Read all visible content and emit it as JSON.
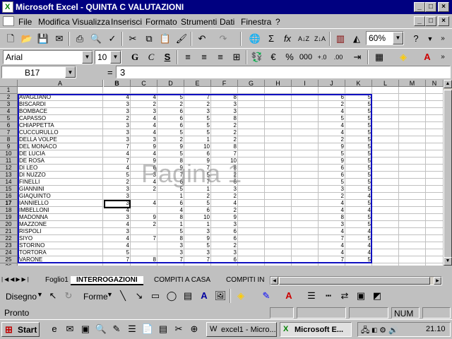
{
  "window": {
    "title": "Microsoft Excel - QUINTA C VALUTAZIONI"
  },
  "menu": [
    "File",
    "Modifica",
    "Visualizza",
    "Inserisci",
    "Formato",
    "Strumenti",
    "Dati",
    "Finestra",
    "?"
  ],
  "toolbar1": {
    "zoom": "60%"
  },
  "toolbar2": {
    "font": "Arial",
    "size": "10"
  },
  "formula": {
    "namebox": "B17",
    "eq": "=",
    "value": "3"
  },
  "columns": [
    "A",
    "B",
    "C",
    "D",
    "E",
    "F",
    "G",
    "H",
    "I",
    "J",
    "K",
    "L",
    "M",
    "N"
  ],
  "rows": [
    {
      "n": "1",
      "name": "",
      "b": "",
      "c": "",
      "d": "",
      "e": "",
      "f": "",
      "j": "",
      "k": ""
    },
    {
      "n": "2",
      "name": "AVAGLIANO",
      "b": "4",
      "c": "4",
      "d": "5",
      "e": "7",
      "f": "8",
      "j": "6",
      "k": "5"
    },
    {
      "n": "3",
      "name": "BISCARDI",
      "b": "3",
      "c": "2",
      "d": "2",
      "e": "2",
      "f": "3",
      "j": "2",
      "k": "5"
    },
    {
      "n": "4",
      "name": "BOMBACE",
      "b": "3",
      "c": "3",
      "d": "6",
      "e": "3",
      "f": "3",
      "j": "4",
      "k": "5"
    },
    {
      "n": "5",
      "name": "CAPASSO",
      "b": "2",
      "c": "4",
      "d": "6",
      "e": "5",
      "f": "8",
      "j": "5",
      "k": "5"
    },
    {
      "n": "6",
      "name": "CHIAPPETTA",
      "b": "3",
      "c": "4",
      "d": "6",
      "e": "5",
      "f": "2",
      "j": "4",
      "k": "5"
    },
    {
      "n": "7",
      "name": "CUCCURULLO",
      "b": "3",
      "c": "4",
      "d": "5",
      "e": "5",
      "f": "2",
      "j": "4",
      "k": "5"
    },
    {
      "n": "8",
      "name": "DELLA VOLPE",
      "b": "3",
      "c": "3",
      "d": "2",
      "e": "1",
      "f": "2",
      "j": "2",
      "k": "5"
    },
    {
      "n": "9",
      "name": "DEL MONACO",
      "b": "7",
      "c": "9",
      "d": "9",
      "e": "10",
      "f": "8",
      "j": "9",
      "k": "5"
    },
    {
      "n": "10",
      "name": "DE LUCIA",
      "b": "4",
      "c": "4",
      "d": "5",
      "e": "6",
      "f": "7",
      "j": "5",
      "k": "5"
    },
    {
      "n": "11",
      "name": "DE ROSA",
      "b": "7",
      "c": "9",
      "d": "8",
      "e": "9",
      "f": "10",
      "j": "9",
      "k": "5"
    },
    {
      "n": "12",
      "name": "DI LEO",
      "b": "4",
      "c": "6",
      "d": "9",
      "e": "7",
      "f": "8",
      "j": "6",
      "k": "5"
    },
    {
      "n": "13",
      "name": "DI NUZZO",
      "b": "5",
      "c": "3",
      "d": "7",
      "e": "5",
      "f": "2",
      "j": "6",
      "k": "5"
    },
    {
      "n": "14",
      "name": "FINELLI",
      "b": "2",
      "c": "4",
      "d": "6",
      "e": "7",
      "f": "6",
      "j": "5",
      "k": "5"
    },
    {
      "n": "15",
      "name": "GIANNINI",
      "b": "3",
      "c": "2",
      "d": "5",
      "e": "1",
      "f": "3",
      "j": "3",
      "k": "5"
    },
    {
      "n": "16",
      "name": "GIAQUINTO",
      "b": "3",
      "c": "",
      "d": "1",
      "e": "2",
      "f": "2",
      "j": "2",
      "k": "4"
    },
    {
      "n": "17",
      "name": "IANNIELLO",
      "b": "3",
      "c": "4",
      "d": "6",
      "e": "5",
      "f": "4",
      "j": "4",
      "k": "5"
    },
    {
      "n": "18",
      "name": "IMBELLONI",
      "b": "4",
      "c": "",
      "d": "4",
      "e": "6",
      "f": "2",
      "j": "4",
      "k": "4"
    },
    {
      "n": "19",
      "name": "MADONNA",
      "b": "3",
      "c": "9",
      "d": "8",
      "e": "10",
      "f": "9",
      "j": "8",
      "k": "5"
    },
    {
      "n": "20",
      "name": "MAZZONE",
      "b": "4",
      "c": "2",
      "d": "1",
      "e": "1",
      "f": "3",
      "j": "3",
      "k": "5"
    },
    {
      "n": "21",
      "name": "RISPOLI",
      "b": "3",
      "c": "",
      "d": "5",
      "e": "3",
      "f": "6",
      "j": "4",
      "k": "4"
    },
    {
      "n": "22",
      "name": "SIYO",
      "b": "4",
      "c": "7",
      "d": "8",
      "e": "9",
      "f": "6",
      "j": "7",
      "k": "5"
    },
    {
      "n": "23",
      "name": "STORINO",
      "b": "4",
      "c": "",
      "d": "3",
      "e": "5",
      "f": "2",
      "j": "4",
      "k": "4"
    },
    {
      "n": "24",
      "name": "TORTORA",
      "b": "5",
      "c": "",
      "d": "3",
      "e": "3",
      "f": "3",
      "j": "4",
      "k": "4"
    },
    {
      "n": "25",
      "name": "VARONE",
      "b": "7",
      "c": "8",
      "d": "7",
      "e": "7",
      "f": "6",
      "j": "7",
      "k": "5"
    },
    {
      "n": "26",
      "name": "",
      "b": "",
      "c": "",
      "d": "",
      "e": "",
      "f": "",
      "j": "",
      "k": ""
    },
    {
      "n": "27",
      "name": "",
      "b": "",
      "c": "",
      "d": "",
      "e": "",
      "f": "",
      "j": "",
      "k": ""
    }
  ],
  "watermark": "Pagina 1",
  "sheets": [
    "Foglio1",
    "INTERROGAZIONI",
    "COMPITI A CASA",
    "COMPITI IN"
  ],
  "drawbar": {
    "draw": "Disegno",
    "shapes": "Forme"
  },
  "status": {
    "left": "Pronto",
    "num": "NUM"
  },
  "taskbar": {
    "start": "Start",
    "task1": "excel1 - Micro...",
    "task2": "Microsoft E...",
    "clock": "21.10"
  }
}
